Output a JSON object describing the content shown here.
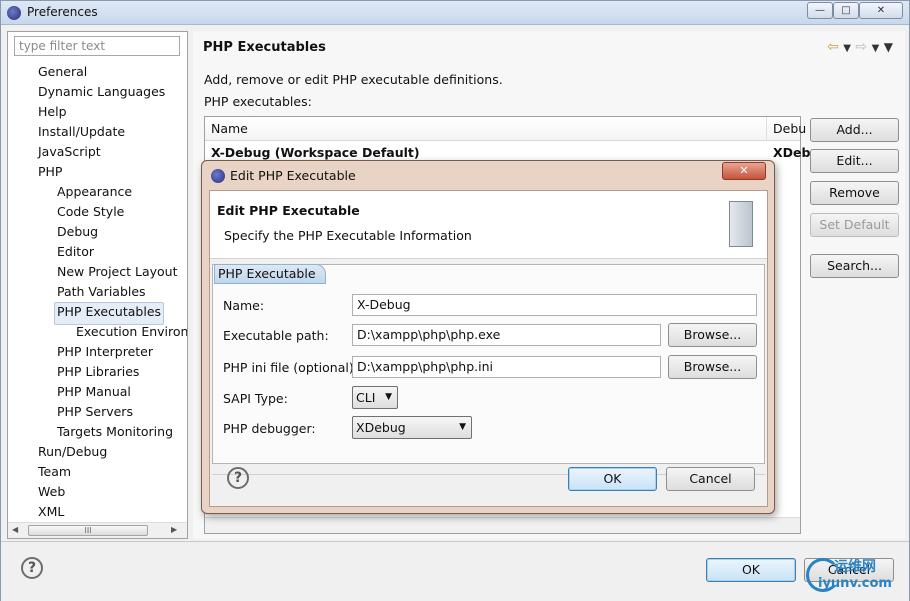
{
  "window": {
    "title": "Preferences",
    "controls": [
      "—",
      "□",
      "✕"
    ]
  },
  "sidebar": {
    "filter_placeholder": "type filter text",
    "items": [
      {
        "label": "General",
        "level": 0
      },
      {
        "label": "Dynamic Languages",
        "level": 0
      },
      {
        "label": "Help",
        "level": 0
      },
      {
        "label": "Install/Update",
        "level": 0
      },
      {
        "label": "JavaScript",
        "level": 0
      },
      {
        "label": "PHP",
        "level": 0
      },
      {
        "label": "Appearance",
        "level": 1
      },
      {
        "label": "Code Style",
        "level": 1
      },
      {
        "label": "Debug",
        "level": 1
      },
      {
        "label": "Editor",
        "level": 1
      },
      {
        "label": "New Project Layout",
        "level": 1
      },
      {
        "label": "Path Variables",
        "level": 1
      },
      {
        "label": "PHP Executables",
        "level": 1,
        "selected": true
      },
      {
        "label": "Execution Environi",
        "level": 2
      },
      {
        "label": "PHP Interpreter",
        "level": 1
      },
      {
        "label": "PHP Libraries",
        "level": 1
      },
      {
        "label": "PHP Manual",
        "level": 1
      },
      {
        "label": "PHP Servers",
        "level": 1
      },
      {
        "label": "Targets Monitoring",
        "level": 1
      },
      {
        "label": "Run/Debug",
        "level": 0
      },
      {
        "label": "Team",
        "level": 0
      },
      {
        "label": "Web",
        "level": 0
      },
      {
        "label": "XML",
        "level": 0
      }
    ],
    "scroll_thumb": "III"
  },
  "page": {
    "title": "PHP Executables",
    "description": "Add, remove or edit PHP executable definitions.",
    "list_label": "PHP executables:",
    "table": {
      "headers": [
        "Name",
        "Debu"
      ],
      "rows": [
        {
          "name": "X-Debug (Workspace Default)",
          "debugger": "XDeb"
        }
      ]
    },
    "buttons": {
      "add": "Add...",
      "edit": "Edit...",
      "remove": "Remove",
      "set_default": "Set Default",
      "search": "Search..."
    }
  },
  "footer": {
    "ok": "OK",
    "cancel": "Cancel"
  },
  "watermark": {
    "line1": "运维网",
    "line2": "iyunv.com"
  },
  "dialog": {
    "title": "Edit PHP Executable",
    "close": "✕",
    "heading": "Edit PHP Executable",
    "subheading": "Specify the PHP Executable Information",
    "tab": "PHP Executable",
    "fields": {
      "name_label": "Name:",
      "name_value": "X-Debug",
      "exe_label": "Executable path:",
      "exe_value": "D:\\xampp\\php\\php.exe",
      "ini_label": "PHP ini file (optional):",
      "ini_value": "D:\\xampp\\php\\php.ini",
      "sapi_label": "SAPI Type:",
      "sapi_value": "CLI",
      "debugger_label": "PHP debugger:",
      "debugger_value": "XDebug",
      "browse": "Browse..."
    },
    "ok": "OK",
    "cancel": "Cancel"
  },
  "colors": {
    "accent": "#3c7fb1",
    "dialog_frame": "#e8d3c4",
    "close_button": "#c6533c"
  }
}
